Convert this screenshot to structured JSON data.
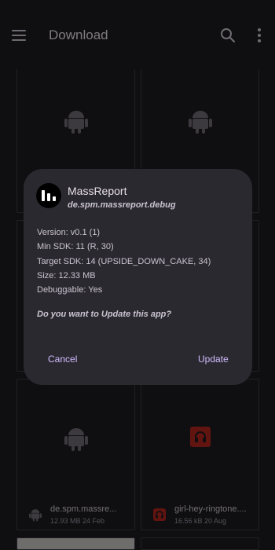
{
  "appbar": {
    "title": "Download",
    "menu_icon": "menu-icon",
    "search_icon": "search-icon",
    "more_icon": "more-vert-icon"
  },
  "files": [
    {
      "name": "",
      "meta": "",
      "icon": "android-icon"
    },
    {
      "name": "",
      "meta": "",
      "icon": "android-icon"
    },
    {
      "name": "",
      "meta": "",
      "icon": "android-icon"
    },
    {
      "name": "",
      "meta": "",
      "icon": "android-icon"
    },
    {
      "name": "",
      "meta": "",
      "icon": "android-icon"
    },
    {
      "name": "",
      "meta": "",
      "icon": "android-icon"
    },
    {
      "name": "de.spm.massre...",
      "meta": "12.93 MB 24 Feb",
      "icon": "android-icon"
    },
    {
      "name": "girl-hey-ringtone....",
      "meta": "16.56 kB 20 Aug",
      "icon": "audio-file-icon"
    }
  ],
  "dialog": {
    "app_name": "MassReport",
    "package": "de.spm.massreport.debug",
    "version": "Version: v0.1 (1)",
    "min_sdk": "Min SDK: 11 (R, 30)",
    "target_sdk": "Target SDK: 14 (UPSIDE_DOWN_CAKE, 34)",
    "size": "Size: 12.33 MB",
    "debuggable": "Debuggable: Yes",
    "question": "Do you want to Update this app?",
    "cancel_label": "Cancel",
    "update_label": "Update"
  },
  "colors": {
    "background": "#1c1b1f",
    "dialog": "#2b2930",
    "accent": "#d0bcff",
    "audio_icon": "#b3261e",
    "droid": "#6f6b73"
  }
}
